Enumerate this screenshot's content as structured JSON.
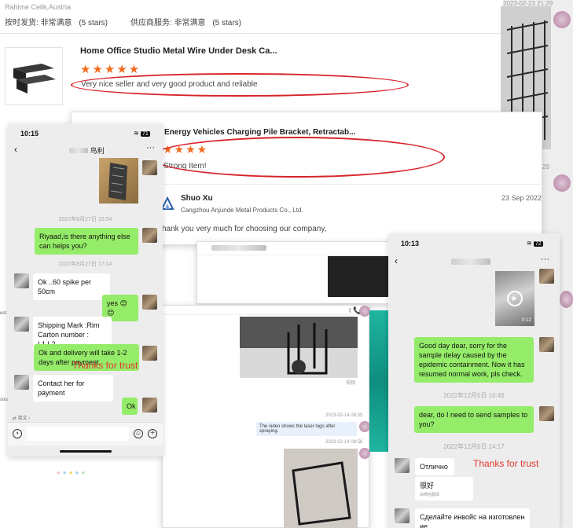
{
  "background_review": {
    "reviewer": "Rahime Celik,Austria",
    "shipping_label": "按时发货:",
    "shipping_value": "非常满意",
    "shipping_stars": "(5 stars)",
    "service_label": "供应商服务:",
    "service_value": "非常满意",
    "service_stars": "(5 stars)",
    "right_timestamp": "2023-02-23 21:29",
    "partial_29": "29"
  },
  "review_1": {
    "product_title": "Home Office Studio Metal Wire Under Desk Ca...",
    "stars": "★★★★★",
    "comment": "Very nice seller and very good product and reliable"
  },
  "review_2": {
    "product_title": "Energy Vehicles Charging Pile Bracket, Retractab...",
    "stars": "★★★★",
    "comment": "Strong Item!",
    "responder_name": "Shuo Xu",
    "responder_company": "Cangzhou Anjunde Metal Products Co., Ltd.",
    "response_date": "23 Sep 2022",
    "response_text": "hank you very much for choosing our company,"
  },
  "chat_left": {
    "status_time": "10:15",
    "battery": "71",
    "contact_name": "鸟利",
    "messages": [
      {
        "type": "time",
        "text": "2022年8月27日 16:54"
      },
      {
        "type": "out",
        "text": "Riyaad,is there anything else can helps you?"
      },
      {
        "type": "time",
        "text": "2022年8月27日 17:14"
      },
      {
        "type": "in",
        "text": "Ok ..60 spike per 50cm"
      },
      {
        "type": "out",
        "text": "yes 😊😊"
      },
      {
        "type": "in",
        "text": "Shipping Mark :Rim\nCarton number : L1,L2....."
      },
      {
        "type": "out",
        "text": "Ok and delivery will take 1-2 days after payment"
      },
      {
        "type": "in",
        "text": "Contact her for payment"
      },
      {
        "type": "out",
        "text": "Ok"
      }
    ],
    "thanks": "Thanks for trust",
    "translate_label": "英文",
    "left_edge_1": "est",
    "left_edge_2": "sou"
  },
  "middle_chat": {
    "header_icons": "🕻 📞",
    "ts1": "2023-02-14 08:55",
    "video_caption": "The video shows the laser logo after spraying.",
    "ts2": "2023-02-14 08:56",
    "file_label": "视频"
  },
  "chat_right": {
    "status_time": "10:13",
    "battery": "72",
    "video_duration": "0:12",
    "messages": [
      {
        "type": "out",
        "text": "Good day dear, sorry for the sample delay caused by the epidemic containment. Now it has resumed normal work, pls check."
      },
      {
        "type": "time",
        "text": "2022年12月5日 10:46"
      },
      {
        "type": "out",
        "text": "dear, do I need to send samples to you?"
      },
      {
        "type": "time",
        "text": "2022年12月5日 14:17"
      },
      {
        "type": "in",
        "text": "Отлично"
      },
      {
        "type": "in",
        "text": "很好"
      },
      {
        "type": "in",
        "text": "Сделайте инвойс на изготовлен ие"
      }
    ],
    "translate_note": "由微信翻译",
    "thanks": "Thanks for trust"
  }
}
